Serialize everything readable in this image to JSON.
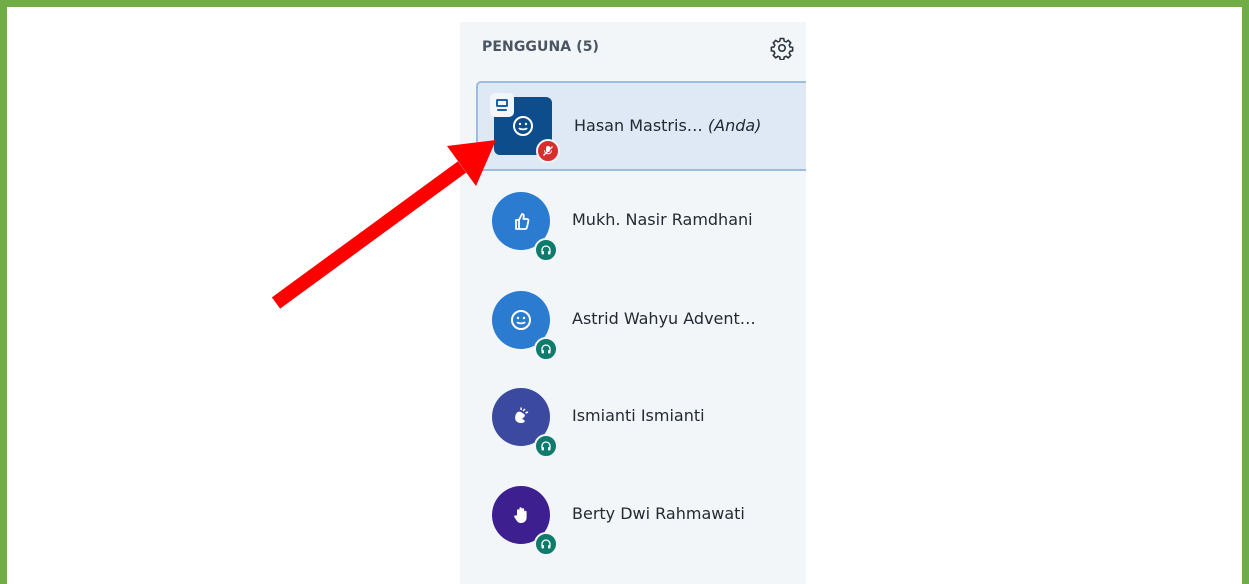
{
  "panel": {
    "title": "PENGGUNA (5)",
    "settings_icon": "gear-icon"
  },
  "users": [
    {
      "name": "Hasan Mastris…",
      "suffix": "(Anda)",
      "avatar_icon": "smiley-icon",
      "avatar_color": "#0e4d8c",
      "status_icon": "muted-mic-icon",
      "status_color": "#d92e2e",
      "presenter": true,
      "current_user": true
    },
    {
      "name": "Mukh. Nasir Ramdhani",
      "avatar_icon": "thumbs-up-icon",
      "avatar_color": "#2b7bd1",
      "status_icon": "listen-only-headphone-icon",
      "status_color": "#0f7b6c"
    },
    {
      "name": "Astrid Wahyu Advent…",
      "avatar_icon": "smiley-icon",
      "avatar_color": "#2b7bd1",
      "status_icon": "listen-only-headphone-icon",
      "status_color": "#0f7b6c"
    },
    {
      "name": "Ismianti Ismianti",
      "avatar_icon": "applause-icon",
      "avatar_color": "#3b4aa0",
      "status_icon": "listen-only-headphone-icon",
      "status_color": "#0f7b6c"
    },
    {
      "name": "Berty Dwi Rahmawati",
      "avatar_icon": "raise-hand-icon",
      "avatar_color": "#3d1f8f",
      "status_icon": "listen-only-headphone-icon",
      "status_color": "#0f7b6c"
    }
  ],
  "annotation": {
    "arrow_color": "#ff0000",
    "frame_color": "#70ad47"
  }
}
